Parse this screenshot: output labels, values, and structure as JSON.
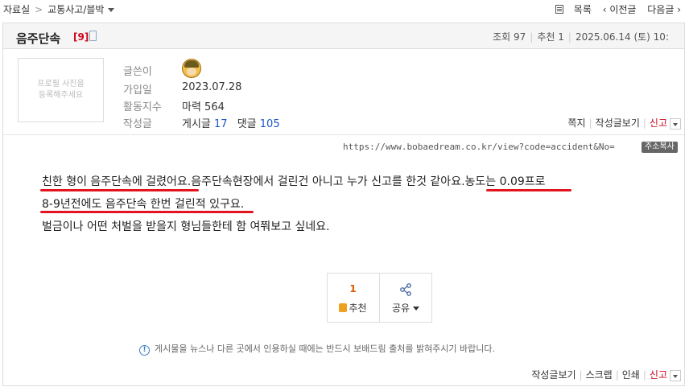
{
  "nav": {
    "crumb_home": "자료실",
    "crumb_sep": ">",
    "crumb_category": "교통사고/블박",
    "list_label": "목록",
    "prev_label": "‹ 이전글",
    "next_label": "다음글 ›"
  },
  "post": {
    "title": "음주단속",
    "comment_count": "[9]",
    "meta": {
      "views_label": "조회",
      "views": "97",
      "recommend_label": "추천",
      "recommend": "1",
      "date": "2025.06.14 (토) 10:"
    }
  },
  "author": {
    "photo_placeholder_line1": "프로필 사진을",
    "photo_placeholder_line2": "등록해주세요",
    "writer_label": "글쓴이",
    "joined_label": "가입일",
    "joined": "2023.07.28",
    "activity_label": "활동지수",
    "activity": "마력 564",
    "posts_label": "작성글",
    "posts_text": "게시글",
    "posts_count": "17",
    "comments_text": "댓글",
    "comments_count": "105",
    "links": {
      "message": "쪽지",
      "view_posts": "작성글보기",
      "report": "신고"
    }
  },
  "share_url": {
    "url": "https://www.bobaedream.co.kr/view?code=accident&No=",
    "copy_button": "주소복사"
  },
  "content": {
    "line1_a": "친한 형이 음주단속에 걸렸어요.",
    "line1_b": "음주단속현장에서 걸린건 아니고 누가 신고를 한것 같아요.",
    "line1_c": "농도는 0.09프로",
    "line2": "8-9년전에도 음주단속 한번 걸린적 있구요.",
    "line3": "벌금이나 어떤 처벌을 받을지 형님들한테 함 여쭤보고 싶네요."
  },
  "actions": {
    "recommend_count": "1",
    "recommend_label": "추천",
    "share_label": "공유"
  },
  "notice": "게시물을 뉴스나 다른 곳에서 인용하실 때에는 반드시 보배드림 출처를 밝혀주시기 바랍니다.",
  "footer_links": {
    "view_posts": "작성글보기",
    "scrap": "스크랩",
    "print": "인쇄",
    "report": "신고"
  },
  "colors": {
    "accent_red": "#d0021b",
    "underline_red": "#e2141f",
    "link_blue": "#1a56c8",
    "recommend_orange": "#e05a00"
  }
}
